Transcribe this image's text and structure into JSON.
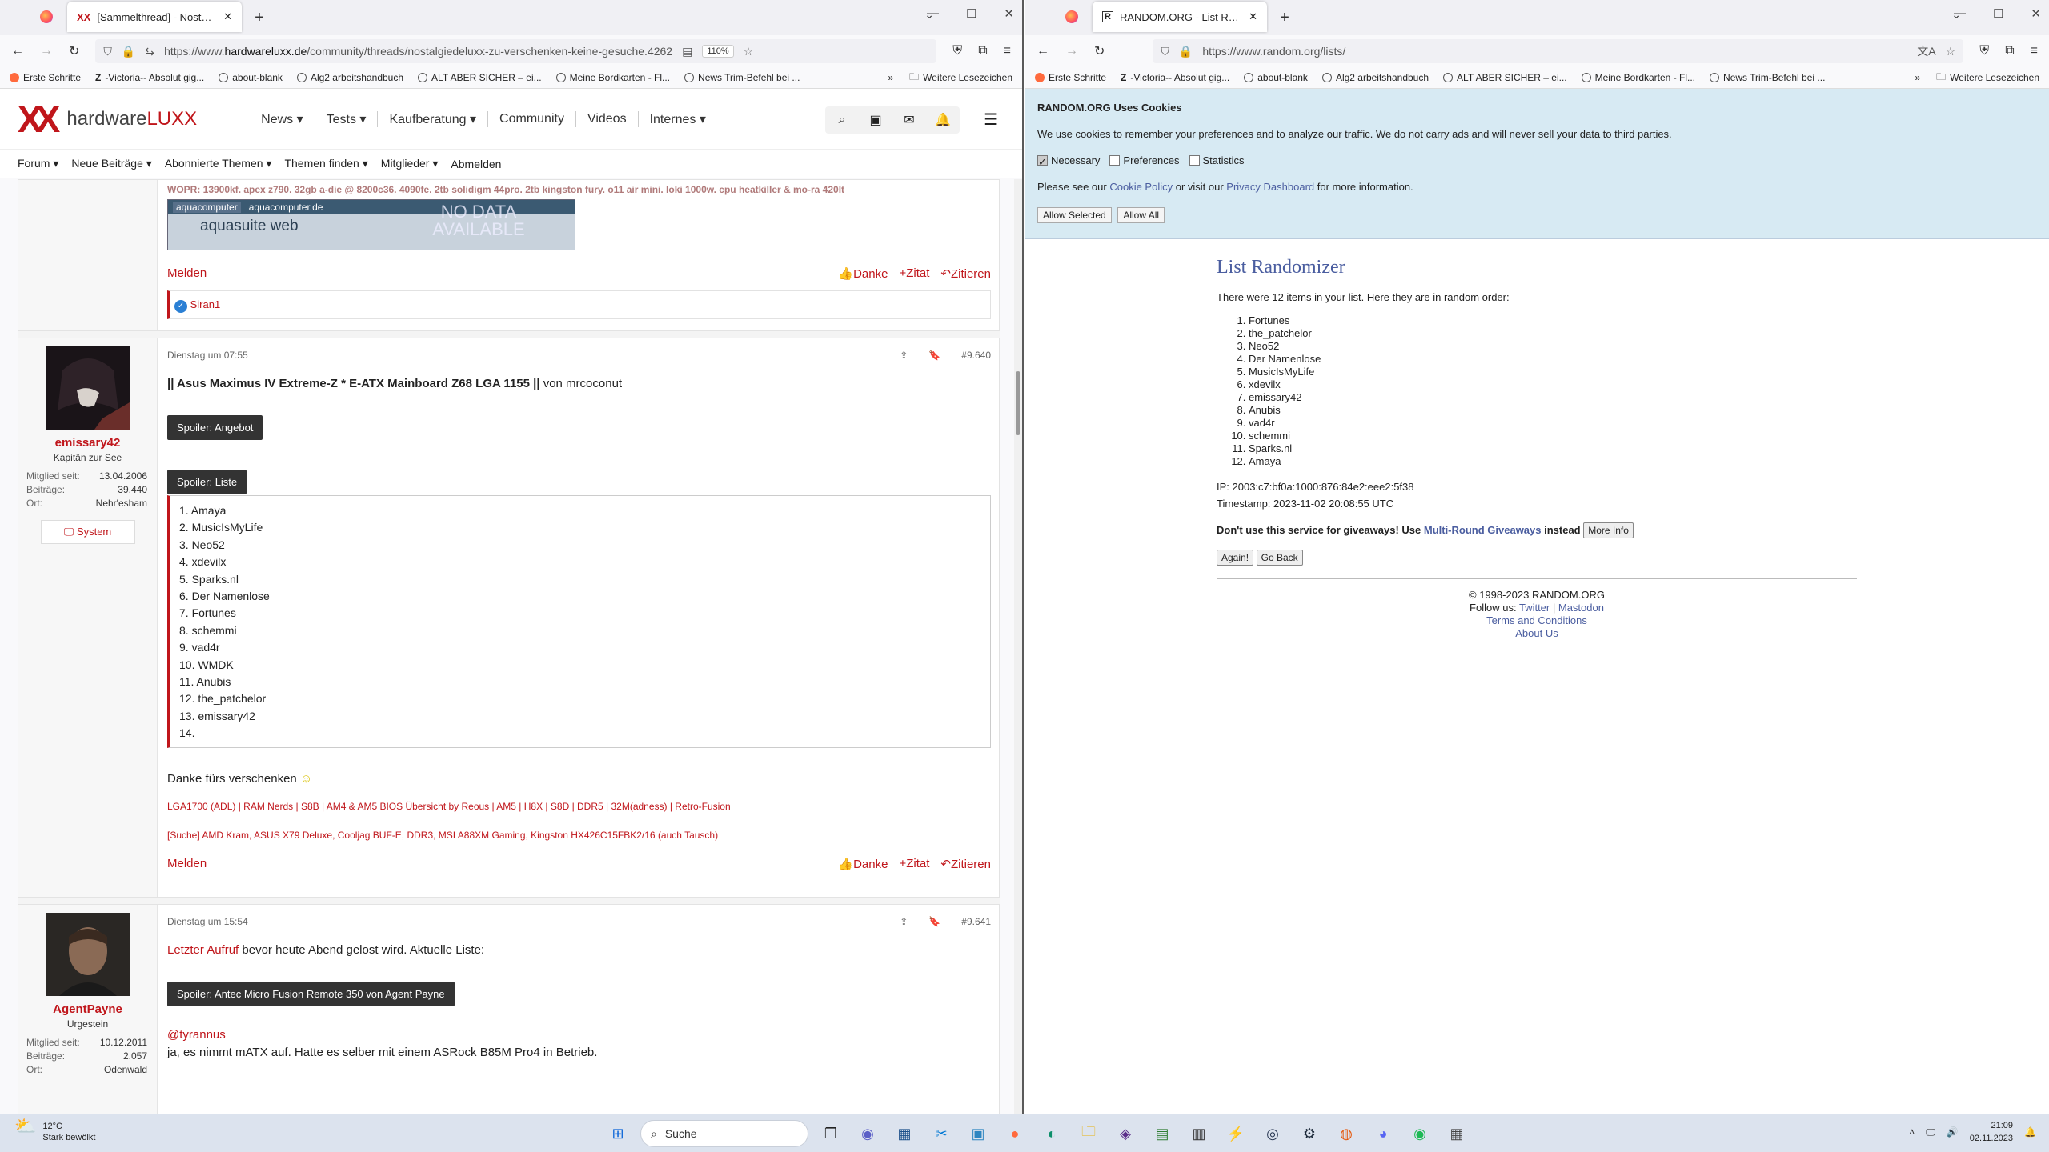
{
  "left": {
    "tab_title": "[Sammelthread] - NostalgieDeLuxx",
    "url_prefix": "https://www.",
    "url_host": "hardwareluxx.de",
    "url_path": "/community/threads/nostalgiedeluxx-zu-verschenken-keine-gesuche.4262",
    "zoom": "110%",
    "bookmarks": [
      "Erste Schritte",
      "-Victoria-- Absolut gig...",
      "about-blank",
      "Alg2 arbeitshandbuch",
      "ALT ABER SICHER – ei...",
      "Meine Bordkarten - Fl...",
      "News Trim-Befehl bei ..."
    ],
    "bookmarks_more": "Weitere Lesezeichen",
    "logo_prefix": "hardware",
    "logo_suffix": "LUXX",
    "nav": [
      "News",
      "Tests",
      "Kaufberatung",
      "Community",
      "Videos",
      "Internes"
    ],
    "subnav": [
      "Forum",
      "Neue Beiträge",
      "Abonnierte Themen",
      "Themen finden",
      "Mitglieder",
      "Abmelden"
    ],
    "prev_post": {
      "sig": "WOPR: 13900kf. apex z790. 32gb a-die @ 8200c36. 4090fe. 2tb solidigm 44pro. 2tb kingston fury. o11 air mini. loki 1000w. cpu heatkiller & mo-ra 420lt",
      "banner_brand": "aquacomputer",
      "banner_site": "aquacomputer.de",
      "banner_app": "aquasuite web",
      "banner_nodata": "NO DATA AVAILABLE",
      "melden": "Melden",
      "danke": "Danke",
      "zitat": "+Zitat",
      "zitieren": "Zitieren",
      "reaction_user": "Siran1"
    },
    "post1": {
      "username": "emissary42",
      "title": "Kapitän zur See",
      "stats": [
        [
          "Mitglied seit:",
          "13.04.2006"
        ],
        [
          "Beiträge:",
          "39.440"
        ],
        [
          "Ort:",
          "Nehr'esham"
        ]
      ],
      "system": "System",
      "date": "Dienstag um 07:55",
      "number": "#9.640",
      "headline": "|| Asus Maximus IV Extreme-Z * E-ATX Mainboard Z68 LGA 1155 ||",
      "by": " von mrcoconut",
      "spoiler1": "Spoiler: Angebot",
      "spoiler2": "Spoiler: Liste",
      "list": [
        "1. Amaya",
        "2. MusicIsMyLife",
        "3. Neo52",
        "4. xdevilx",
        "5. Sparks.nl",
        "6. Der Namenlose",
        "7. Fortunes",
        "8. schemmi",
        "9. vad4r",
        "10. WMDK",
        "11. Anubis",
        "12. the_patchelor",
        "13. emissary42",
        "14."
      ],
      "thanks": "Danke fürs verschenken",
      "sig1": "LGA1700 (ADL) | RAM Nerds | S8B | AM4 & AM5 BIOS Übersicht by Reous | AM5 | H8X | S8D | DDR5 | 32M(adness) | Retro-Fusion",
      "sig2": "[Suche] AMD Kram, ASUS X79 Deluxe, Cooljag BUF-E, DDR3, MSI A88XM Gaming, Kingston HX426C15FBK2/16 (auch Tausch)"
    },
    "post2": {
      "username": "AgentPayne",
      "title": "Urgestein",
      "stats": [
        [
          "Mitglied seit:",
          "10.12.2011"
        ],
        [
          "Beiträge:",
          "2.057"
        ],
        [
          "Ort:",
          "Odenwald"
        ]
      ],
      "date": "Dienstag um 15:54",
      "number": "#9.641",
      "link": "Letzter Aufruf",
      "text1": " bevor heute Abend gelost wird. Aktuelle Liste:",
      "spoiler": "Spoiler: Antec Micro Fusion Remote 350 von Agent Payne",
      "mention": "@tyrannus",
      "text2": "ja, es nimmt mATX auf. Hatte es selber mit einem ASRock B85M Pro4 in Betrieb."
    }
  },
  "right": {
    "tab_title": "RANDOM.ORG - List Randomizer",
    "url": "https://www.random.org/lists/",
    "cookie_title": "RANDOM.ORG Uses Cookies",
    "cookie_text": "We use cookies to remember your preferences and to analyze our traffic. We do not carry ads and will never sell your data to third parties.",
    "checks": [
      "Necessary",
      "Preferences",
      "Statistics"
    ],
    "policy_pre": "Please see our ",
    "policy_link": "Cookie Policy",
    "policy_mid": " or visit our ",
    "privacy_link": "Privacy Dashboard",
    "policy_post": " for more information.",
    "allow_selected": "Allow Selected",
    "allow_all": "Allow All",
    "heading": "List Randomizer",
    "intro": "There were 12 items in your list. Here they are in random order:",
    "items": [
      "Fortunes",
      "the_patchelor",
      "Neo52",
      "Der Namenlose",
      "MusicIsMyLife",
      "xdevilx",
      "emissary42",
      "Anubis",
      "vad4r",
      "schemmi",
      "Sparks.nl",
      "Amaya"
    ],
    "ip": "IP: 2003:c7:bf0a:1000:876:84e2:eee2:5f38",
    "timestamp": "Timestamp: 2023-11-02 20:08:55 UTC",
    "warn_pre": "Don't use this service for giveaways! Use ",
    "warn_link": "Multi-Round Giveaways",
    "warn_post": " instead",
    "more_info": "More Info",
    "again": "Again!",
    "go_back": "Go Back",
    "copyright": "© 1998-2023 RANDOM.ORG",
    "follow": "Follow us: ",
    "twitter": "Twitter",
    "mastodon": "Mastodon",
    "terms": "Terms and Conditions",
    "about": "About Us"
  },
  "taskbar": {
    "temp": "12°C",
    "weather": "Stark bewölkt",
    "search": "Suche",
    "time": "21:09",
    "date": "02.11.2023"
  }
}
